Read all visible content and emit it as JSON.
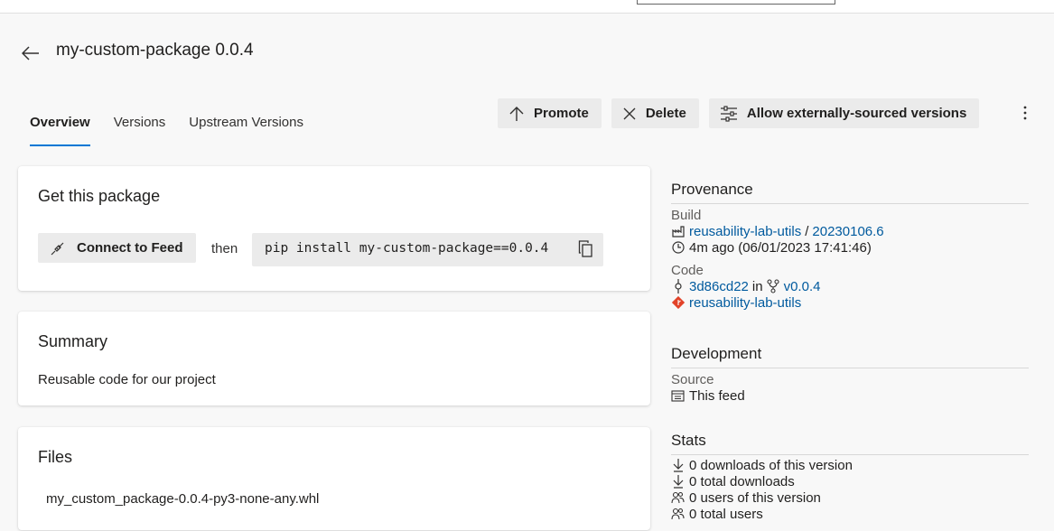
{
  "header": {
    "title": "my-custom-package 0.0.4"
  },
  "tabs": [
    {
      "label": "Overview"
    },
    {
      "label": "Versions"
    },
    {
      "label": "Upstream Versions"
    }
  ],
  "actions": {
    "promote": "Promote",
    "delete": "Delete",
    "allow_external": "Allow externally-sourced versions"
  },
  "get_package": {
    "title": "Get this package",
    "connect_label": "Connect to Feed",
    "then": "then",
    "command": "pip install my-custom-package==0.0.4"
  },
  "summary": {
    "title": "Summary",
    "text": "Reusable code for our project"
  },
  "files": {
    "title": "Files",
    "items": [
      "my_custom_package-0.0.4-py3-none-any.whl"
    ]
  },
  "provenance": {
    "title": "Provenance",
    "build_label": "Build",
    "pipeline": "reusability-lab-utils",
    "separator": "/",
    "build_number": "20230106.6",
    "time": "4m ago (06/01/2023 17:41:46)",
    "code_label": "Code",
    "commit": "3d86cd22",
    "in_word": "in",
    "tag": "v0.0.4",
    "repo": "reusability-lab-utils"
  },
  "development": {
    "title": "Development",
    "source_label": "Source",
    "source": "This feed"
  },
  "stats": {
    "title": "Stats",
    "downloads_version": "0 downloads of this version",
    "downloads_total": "0 total downloads",
    "users_version": "0 users of this version",
    "users_total": "0 total users"
  },
  "colors": {
    "accent": "#0078d4",
    "link": "#005a9e",
    "git": "#e24329"
  }
}
